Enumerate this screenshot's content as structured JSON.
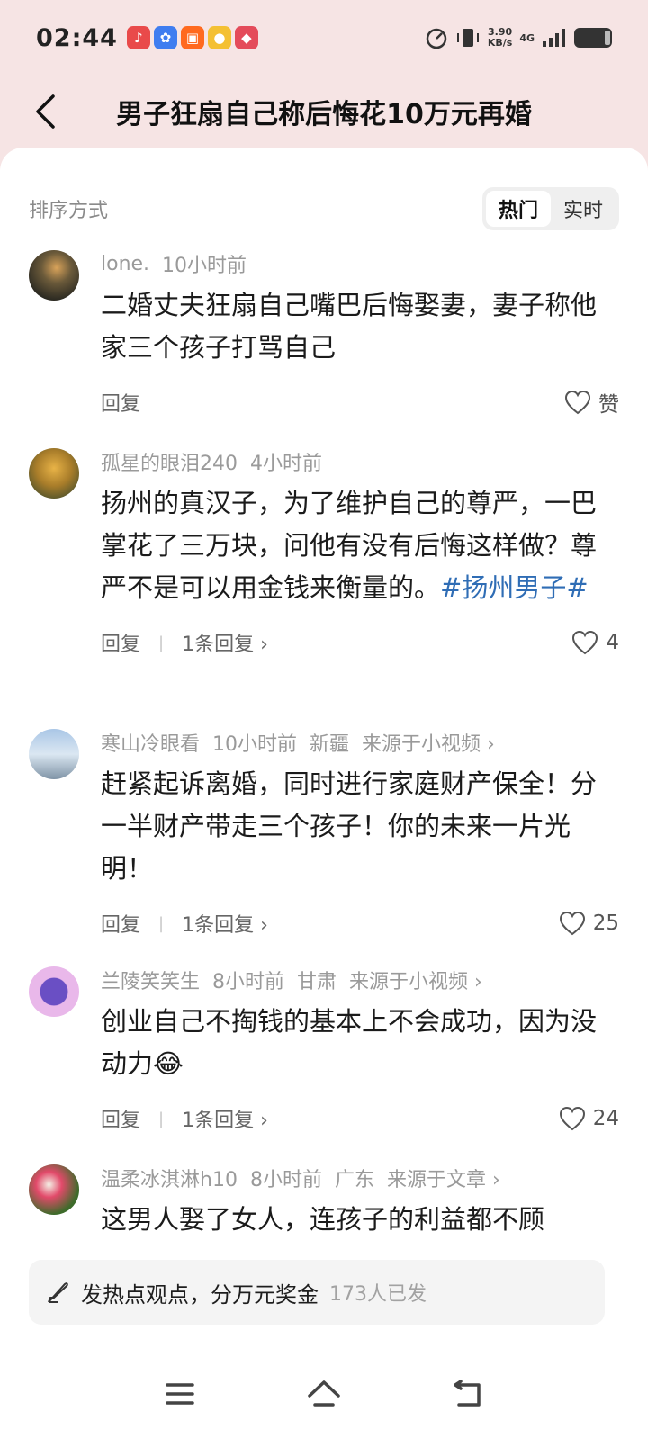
{
  "status": {
    "time": "02:44",
    "speed_value": "3.90",
    "speed_unit": "KB/s",
    "network": "4G",
    "app_icons": [
      "douyin-icon",
      "baidu-icon",
      "kuaishou-icon",
      "toutiao-icon",
      "game-icon"
    ]
  },
  "header": {
    "title": "男子狂扇自己称后悔花10万元再婚"
  },
  "sort": {
    "label": "排序方式",
    "options": [
      "热门",
      "实时"
    ],
    "active": "热门"
  },
  "comments": [
    {
      "user": "lone.",
      "time": "10小时前",
      "text": "二婚丈夫狂扇自己嘴巴后悔娶妻，妻子称他家三个孩子打骂自己",
      "reply_label": "回复",
      "likes": "赞"
    },
    {
      "user": "孤星的眼泪240",
      "time": "4小时前",
      "text": "扬州的真汉子，为了维护自己的尊严，一巴掌花了三万块，问他有没有后悔这样做？尊严不是可以用金钱来衡量的。",
      "hashtag": "#扬州男子#",
      "reply_label": "回复",
      "reply_count": "1条回复",
      "likes": "4"
    },
    {
      "user": "寒山冷眼看",
      "time": "10小时前",
      "location": "新疆",
      "source": "来源于小视频",
      "text": "赶紧起诉离婚，同时进行家庭财产保全！分一半财产带走三个孩子！你的未来一片光明！",
      "reply_label": "回复",
      "reply_count": "1条回复",
      "likes": "25"
    },
    {
      "user": "兰陵笑笑生",
      "time": "8小时前",
      "location": "甘肃",
      "source": "来源于小视频",
      "text": "创业自己不掏钱的基本上不会成功，因为没动力😂",
      "reply_label": "回复",
      "reply_count": "1条回复",
      "likes": "24"
    },
    {
      "user": "温柔冰淇淋h10",
      "time": "8小时前",
      "location": "广东",
      "source": "来源于文章",
      "text": "这男人娶了女人，连孩子的利益都不顾"
    }
  ],
  "composer": {
    "hint": "发热点观点，分万元奖金",
    "count": "173人已发"
  }
}
